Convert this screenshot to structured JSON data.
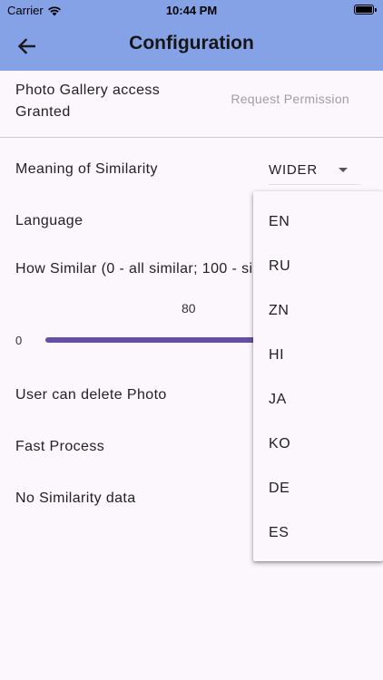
{
  "status_bar": {
    "carrier": "Carrier",
    "time": "10:44 PM"
  },
  "app_bar": {
    "title": "Configuration",
    "background_color": "#86A2E6"
  },
  "settings": {
    "photo_gallery": {
      "label": "Photo Gallery access Granted",
      "button_label": "Request Permission"
    },
    "meaning_of_similarity": {
      "label": "Meaning of Similarity",
      "selected_value": "WIDER"
    },
    "language": {
      "label": "Language"
    },
    "how_similar": {
      "label": "How Similar (0 - all similar; 100 - similar",
      "slider_min": "0",
      "slider_value": "80"
    },
    "delete_photo": {
      "label": "User can delete Photo"
    },
    "fast_process": {
      "label": "Fast Process"
    },
    "similarity_data": {
      "label": "No Similarity data"
    }
  },
  "language_menu": {
    "options": [
      "EN",
      "RU",
      "ZN",
      "HI",
      "JA",
      "KO",
      "DE",
      "ES"
    ]
  },
  "colors": {
    "accent": "#6750A4",
    "background": "#FCF7FD"
  }
}
